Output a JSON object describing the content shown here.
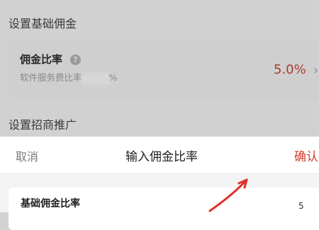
{
  "settings": {
    "base_commission_section": "设置基础佣金",
    "commission_card": {
      "title": "佣金比率",
      "help_icon": "?",
      "subtitle_prefix": "软件服务费比率",
      "subtitle_suffix": "%",
      "rate": "5.0%",
      "chevron": "›"
    },
    "promotion_section": "设置招商推广"
  },
  "sheet": {
    "cancel_label": "取消",
    "title": "输入佣金比率",
    "confirm_label": "确认",
    "input_label": "基础佣金比率",
    "input_value": "5"
  },
  "colors": {
    "accent_red": "#d0402e",
    "arrow_red": "#e0302a"
  }
}
